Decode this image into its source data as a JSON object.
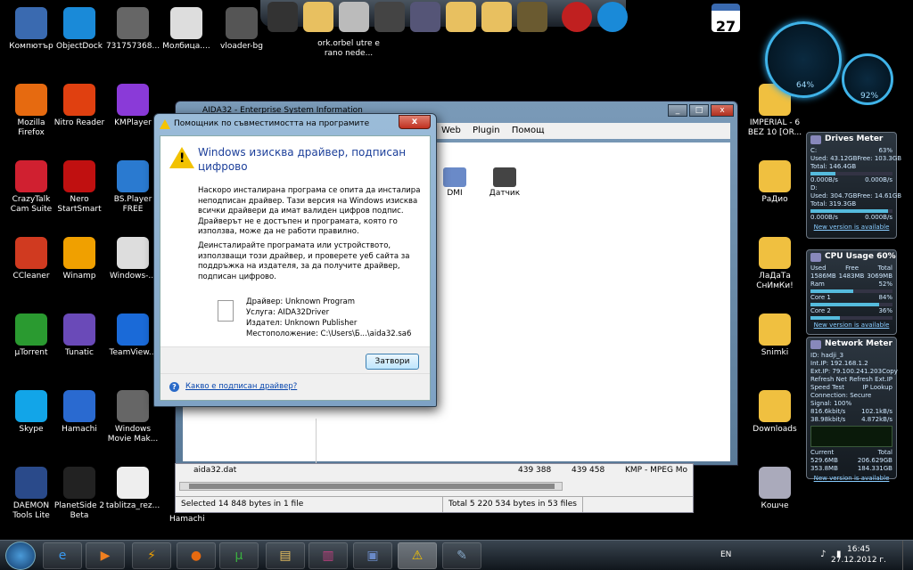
{
  "desktop": {
    "icons": [
      {
        "label": "Компютър",
        "color": "#3a6ab0"
      },
      {
        "label": "ObjectDock",
        "color": "#1a8ad8"
      },
      {
        "label": "731757368...",
        "color": "#666"
      },
      {
        "label": "Молбица....",
        "color": "#ddd"
      },
      {
        "label": "vloader-bg",
        "color": "#555"
      },
      {
        "label": "Mozilla Firefox",
        "color": "#e66a10"
      },
      {
        "label": "Nitro Reader",
        "color": "#e04010"
      },
      {
        "label": "KMPlayer",
        "color": "#8a3ad8"
      },
      {
        "label": "CrazyTalk Cam Suite",
        "color": "#d02030"
      },
      {
        "label": "Nero StartSmart",
        "color": "#c01010"
      },
      {
        "label": "BS.Player FREE",
        "color": "#2a7ad0"
      },
      {
        "label": "CCleaner",
        "color": "#d03a20"
      },
      {
        "label": "Winamp",
        "color": "#f0a000"
      },
      {
        "label": "Windows-...",
        "color": "#ddd"
      },
      {
        "label": "µTorrent",
        "color": "#2a9a30"
      },
      {
        "label": "Tunatic",
        "color": "#6a4ab8"
      },
      {
        "label": "TeamView...",
        "color": "#1a6ad8"
      },
      {
        "label": "Skype",
        "color": "#12a5e8"
      },
      {
        "label": "Hamachi",
        "color": "#2a6ad0"
      },
      {
        "label": "Windows Movie Mak...",
        "color": "#666"
      },
      {
        "label": "DAEMON Tools Lite",
        "color": "#2a4a8a"
      },
      {
        "label": "PlanetSide 2 Beta",
        "color": "#222"
      },
      {
        "label": "tablitza_rez...",
        "color": "#eee"
      },
      {
        "label": "ork.orbel utre e rano nede...",
        "color": "#f0c040"
      },
      {
        "label": "IMPERIAL - 6 BEZ 10 [OR...",
        "color": "#f0c040"
      },
      {
        "label": "РаДио",
        "color": "#f0c040"
      },
      {
        "label": "ЛаДаТа СнИмКи!",
        "color": "#f0c040"
      },
      {
        "label": "Snimki",
        "color": "#f0c040"
      },
      {
        "label": "Downloads",
        "color": "#f0c040"
      },
      {
        "label": "Кошче",
        "color": "#aab"
      }
    ],
    "hamachi_label": "Hamachi"
  },
  "gauges": {
    "cpu": "64%",
    "ram": "92%"
  },
  "drives_meter": {
    "title": "Drives Meter",
    "c_label": "C:",
    "c_pct": "63%",
    "c_used": "Used: 43.12GB",
    "c_free": "Free: 103.3GB",
    "c_total": "Total: 146.4GB",
    "c_read": "0.000B/s",
    "c_write": "0.000B/s",
    "c_fill": 0.3,
    "d_label": "D:",
    "d_used": "Used: 304.7GB",
    "d_free": "Free: 14.61GB",
    "d_total": "Total: 319.3GB",
    "d_read": "0.000B/s",
    "d_write": "0.000B/s",
    "d_fill": 0.95,
    "link": "New version is available"
  },
  "cpu_usage": {
    "title": "CPU Usage",
    "pct": "60%",
    "h_used": "Used",
    "h_free": "Free",
    "h_total": "Total",
    "used": "1586MB",
    "free": "1483MB",
    "total": "3069MB",
    "ram_label": "Ram",
    "ram_pct": "52%",
    "ram_fill": 0.52,
    "core1_label": "Core 1",
    "core1_pct": "84%",
    "core1_fill": 0.84,
    "core2_label": "Core 2",
    "core2_pct": "36%",
    "core2_fill": 0.36,
    "link": "New version is available"
  },
  "network_meter": {
    "title": "Network Meter",
    "id": "ID: hadji_3",
    "int_ip": "Int.IP: 192.168.1.2",
    "ext_ip": "Ext.IP: 79.100.241.203",
    "copy": "Copy",
    "refresh_net": "Refresh Net",
    "refresh_ext": "Refresh Ext.IP",
    "speed_test": "Speed Test",
    "ip_lookup": "IP Lookup",
    "connection": "Connection: Secure",
    "signal": "Signal: 100%",
    "up1": "816.6kbit/s",
    "down1": "102.1kB/s",
    "up2": "38.98kbit/s",
    "down2": "4.872kB/s",
    "current": "Current",
    "total": "Total",
    "cur_up": "529.6MB",
    "cur_down": "353.8MB",
    "tot_up": "206.629GB",
    "tot_down": "184.331GB",
    "link": "New version is available"
  },
  "aida_window": {
    "title": "AIDA32 - Enterprise System Information",
    "menu": [
      "Web",
      "Plugin",
      "Помощ"
    ],
    "objects": [
      "DMI",
      "Датчик"
    ]
  },
  "file_manager": {
    "file_name": "aida32.dat",
    "size1": "439 388",
    "size2": "439 458",
    "type": "KMP - MPEG Mo",
    "status_left": "Selected 14 848 bytes in 1 file",
    "status_right": "Total 5 220 534 bytes in 53 files"
  },
  "dialog": {
    "title": "Помощник по съвместимостта на програмите",
    "close": "x",
    "heading": "Windows изисква драйвер, подписан цифрово",
    "paragraph1": "Наскоро инсталирана програма се опита да инсталира неподписан драйвер. Тази версия на Windows изисква всички драйвери да имат валиден цифров подпис. Драйверът не е достъпен и програмата, която го използва, може да не работи правилно.",
    "paragraph2": "Деинсталирайте програмата или устройството, използващи този драйвер, и проверете уеб сайта за поддръжка на издателя, за да получите драйвер, подписан цифрово.",
    "driver": "Драйвер: Unknown Program",
    "service": "Услуга: AIDA32Driver",
    "publisher": "Издател: Unknown Publisher",
    "location": "Местоположение: C:\\Users\\Б...\\aida32.sa6",
    "close_button": "Затвори",
    "help_link": "Какво е подписан драйвер?"
  },
  "taskbar": {
    "language": "EN",
    "time": "16:45",
    "date": "27.12.2012 г."
  }
}
